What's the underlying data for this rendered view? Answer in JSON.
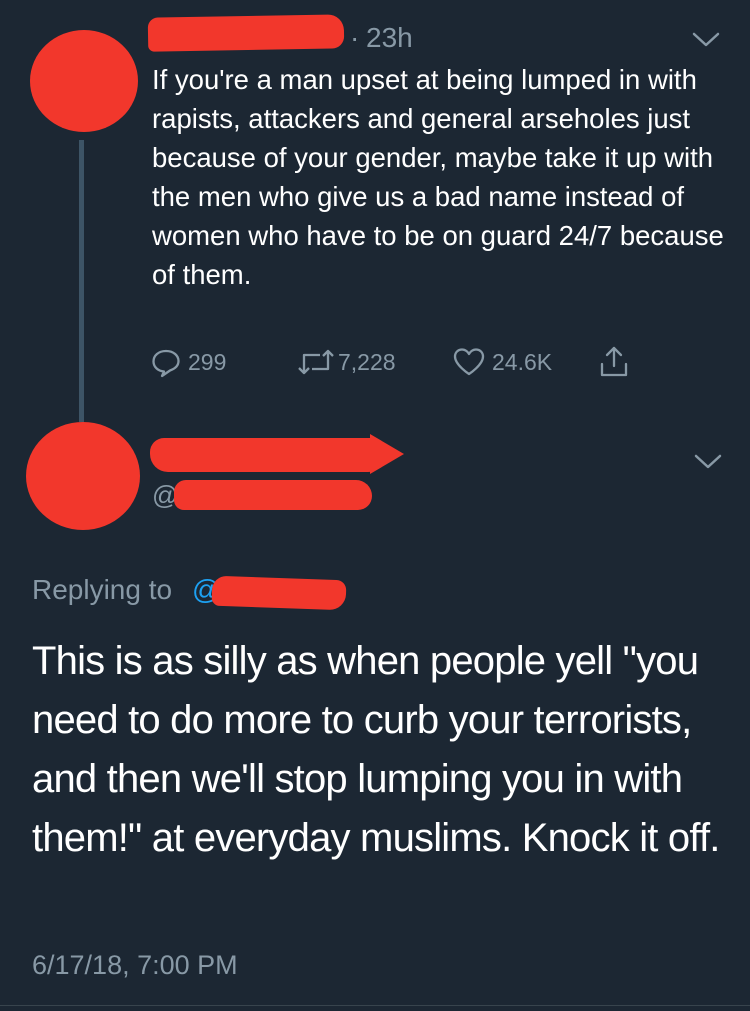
{
  "colors": {
    "background": "#1c2733",
    "text_primary": "#ffffff",
    "text_secondary": "#8899a6",
    "accent": "#1da1f2",
    "redaction": "#f2372c"
  },
  "parent_tweet": {
    "time": "23h",
    "body": "If you're a man upset at being lumped in with rapists, attackers and general arseholes just because of your gender, maybe take it up with the men who give us a bad name instead of women who have to be on guard 24/7 because of them.",
    "replies": "299",
    "retweets": "7,228",
    "likes": "24.6K",
    "icons": [
      "reply-icon",
      "retweet-icon",
      "like-icon",
      "share-icon",
      "chevron-down-icon"
    ]
  },
  "main_tweet": {
    "handle_prefix": "@",
    "replying_label": "Replying to",
    "replying_at": "@",
    "body": "This is as silly as when people yell \"you need to do more to curb your terrorists, and then we'll stop lumping you in with them!\" at everyday muslims. Knock it off.",
    "timestamp": "6/17/18, 7:00 PM"
  }
}
